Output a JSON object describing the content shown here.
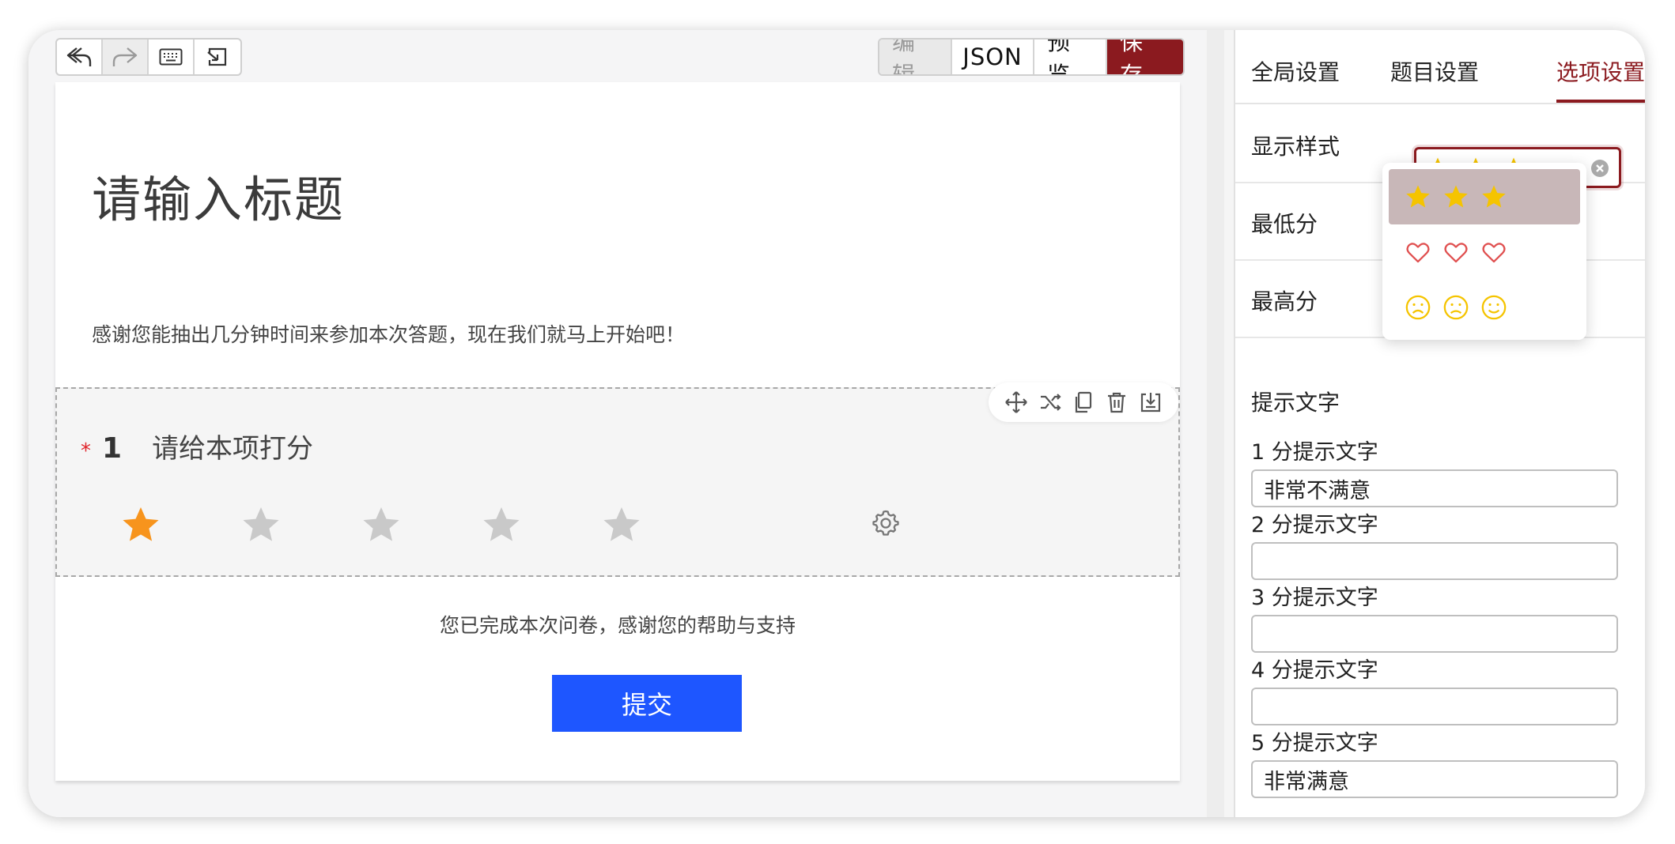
{
  "toolbar": {
    "tools": [
      {
        "name": "undo-icon"
      },
      {
        "name": "redo-icon"
      },
      {
        "name": "keyboard-icon"
      },
      {
        "name": "import-icon"
      }
    ],
    "modes": {
      "edit": "编辑",
      "json": "JSON",
      "preview": "预览",
      "save": "保存"
    }
  },
  "survey": {
    "title": "请输入标题",
    "intro": "感谢您能抽出几分钟时间来参加本次答题，现在我们就马上开始吧！",
    "question": {
      "required_mark": "*",
      "number": "1",
      "text": "请给本项打分",
      "rating": {
        "selected": 1,
        "max": 5
      },
      "actions": [
        "move-icon",
        "shuffle-icon",
        "copy-icon",
        "delete-icon",
        "save-to-bank-icon"
      ]
    },
    "end_text": "您已完成本次问卷，感谢您的帮助与支持",
    "submit_label": "提交"
  },
  "panel": {
    "tabs": [
      "全局设置",
      "题目设置",
      "选项设置"
    ],
    "active_tab": 2,
    "display_style_label": "显示样式",
    "display_style_value": "star",
    "style_options": [
      "star",
      "heart",
      "face"
    ],
    "min_score_label": "最低分",
    "max_score_label": "最高分",
    "hint_title": "提示文字",
    "hints": [
      {
        "label": "1 分提示文字",
        "value": "非常不满意"
      },
      {
        "label": "2 分提示文字",
        "value": ""
      },
      {
        "label": "3 分提示文字",
        "value": ""
      },
      {
        "label": "4 分提示文字",
        "value": ""
      },
      {
        "label": "5 分提示文字",
        "value": "非常满意"
      }
    ]
  },
  "colors": {
    "accent": "#8b1a1f",
    "submit": "#1e56ff",
    "star_active": "#f7941d",
    "star_inactive": "#c9c9c9",
    "style_icon": "#f5c400",
    "heart": "#e05050",
    "required": "#e0252b"
  }
}
